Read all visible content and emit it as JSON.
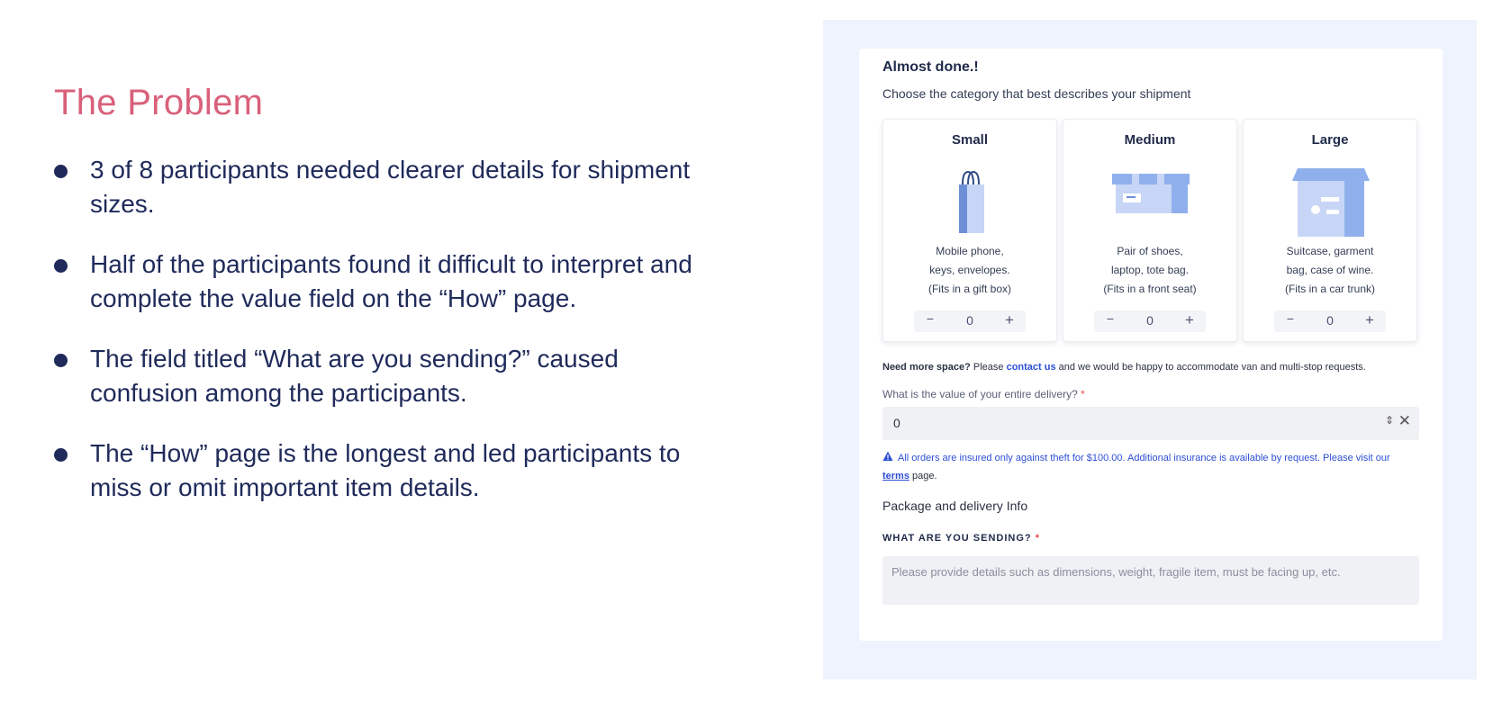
{
  "slide": {
    "title": "The Problem",
    "bullets": [
      "3 of 8 participants needed clearer details for shipment sizes.",
      "Half of the participants found it difficult to interpret and complete the value field on the “How” page.",
      "The field titled “What are you sending?” caused confusion among the participants.",
      "The “How” page is the longest and led participants to miss or omit important item details."
    ]
  },
  "form": {
    "title": "Almost done.!",
    "subtitle": "Choose the category that best describes your shipment",
    "sizes": [
      {
        "name": "Small",
        "line1": "Mobile phone,",
        "line2": "keys, envelopes.",
        "line3": "(Fits in a gift box)",
        "count": "0",
        "icon": "shopping-bag-icon"
      },
      {
        "name": "Medium",
        "line1": "Pair of shoes,",
        "line2": "laptop, tote bag.",
        "line3": "(Fits in a front seat)",
        "count": "0",
        "icon": "flat-box-icon"
      },
      {
        "name": "Large",
        "line1": "Suitcase, garment",
        "line2": "bag, case of wine.",
        "line3": "(Fits in a car trunk)",
        "count": "0",
        "icon": "open-box-icon"
      }
    ],
    "stepper_minus": "−",
    "stepper_plus": "+",
    "need_space_bold": "Need more space?",
    "need_space_pre": " Please ",
    "contact_link": "contact us",
    "need_space_post": " and we would be happy to accommodate van and multi-stop requests.",
    "value_label": "What is the value of your entire delivery?",
    "required_mark": "*",
    "value": "0",
    "spin_icon": "⇕",
    "clear_icon": "✕",
    "notice_text": "All orders are insured only against theft for $100.00. Additional insurance is available by request. Please visit our",
    "terms_link": "terms",
    "notice_tail": " page.",
    "section_head": "Package and delivery Info",
    "sending_label": "WHAT ARE YOU SENDING?",
    "sending_placeholder": "Please provide details such as dimensions, weight, fragile item, must be facing up, etc."
  },
  "colors": {
    "title_accent": "#d9607a",
    "text_navy": "#1f2a5a",
    "link_blue": "#2d4fd6",
    "mock_bg": "#eef3fd",
    "required_red": "#e34a4a"
  }
}
